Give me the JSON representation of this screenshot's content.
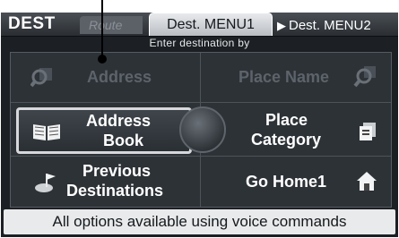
{
  "header": {
    "section": "DEST",
    "route_tab": "Route",
    "menu1_tab": "Dest. MENU1",
    "menu2_tab": "Dest. MENU2"
  },
  "subtitle": "Enter destination by",
  "options": {
    "address": "Address",
    "place_name": "Place Name",
    "address_book": [
      "Address",
      "Book"
    ],
    "place_category": [
      "Place",
      "Category"
    ],
    "previous_destinations": [
      "Previous",
      "Destinations"
    ],
    "go_home": "Go Home1"
  },
  "footer": "All options available using voice commands"
}
